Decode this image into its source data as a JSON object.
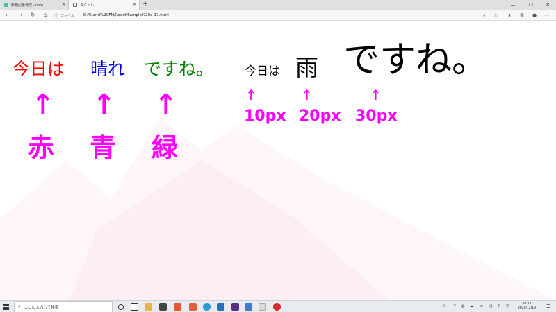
{
  "browser": {
    "tabs": [
      {
        "title": "新規記事作成 - note",
        "active": false
      },
      {
        "title": "タイトル",
        "active": true
      }
    ],
    "new_tab_symbol": "+",
    "address": {
      "scheme_label": "ファイル",
      "url": "D:/Stand%20FM/React/Sample%20a-17.html"
    },
    "window_controls": [
      "—",
      "☐",
      "✕"
    ]
  },
  "content": {
    "colored_words": [
      {
        "text": "今日は",
        "color": "#ff0000"
      },
      {
        "text": "晴れ",
        "color": "#0000ff"
      },
      {
        "text": "ですね。",
        "color": "#008000"
      }
    ],
    "arrow_symbol": "↑",
    "color_labels": [
      "赤",
      "青",
      "緑"
    ],
    "sized_words": [
      {
        "text": "今日は"
      },
      {
        "text": "雨"
      },
      {
        "text": "ですね。"
      }
    ],
    "size_labels": [
      "10px",
      "20px",
      "30px"
    ],
    "annotation_color": "#ff00ff"
  },
  "taskbar": {
    "search_placeholder": "ここに入力して検索",
    "clock_time": "20:17",
    "clock_date": "2020/12/19"
  }
}
